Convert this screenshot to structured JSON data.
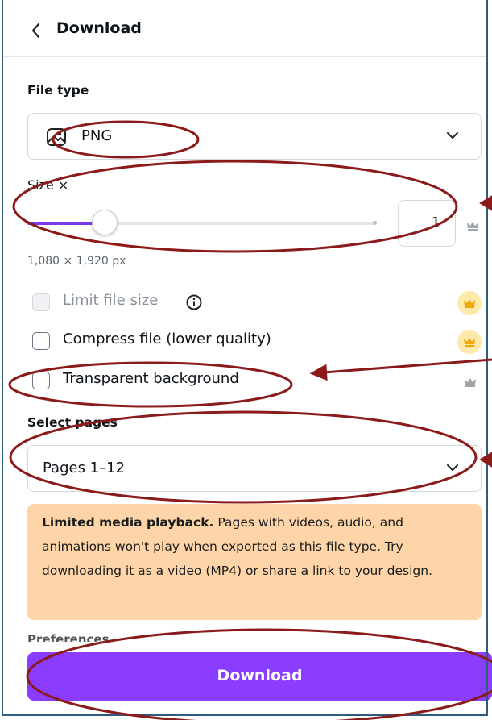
{
  "header": {
    "back_icon": "chevron-left-icon",
    "title": "Download"
  },
  "file_type": {
    "label": "File type",
    "value": "PNG",
    "icon": "image-icon"
  },
  "size": {
    "label": "Size ×",
    "value": "1",
    "slider_fraction": 0.22,
    "dimensions": "1,080 × 1,920 px"
  },
  "options": [
    {
      "label": "Limit file size",
      "checked": false,
      "disabled": true,
      "premium": true
    },
    {
      "label": "Compress file (lower quality)",
      "checked": false,
      "disabled": false,
      "premium": true
    },
    {
      "label": "Transparent background",
      "checked": false,
      "disabled": false,
      "premium": true
    }
  ],
  "pages": {
    "label": "Select pages",
    "value": "Pages 1–12"
  },
  "notice": {
    "bold": "Limited media playback.",
    "text": " Pages with videos, audio, and animations won't play when exported as this file type. Try downloading it as a video (MP4) or ",
    "link": "share a link to your design",
    "end": "."
  },
  "preferences_label": "Preferences",
  "download_button": "Download",
  "colors": {
    "accent": "#8b3dff",
    "slider": "#7c3aed",
    "banner": "#fdd5a8",
    "annotation": "#8b1a1a",
    "premium_badge": "#fde9a9",
    "crown": "#f5a400"
  }
}
